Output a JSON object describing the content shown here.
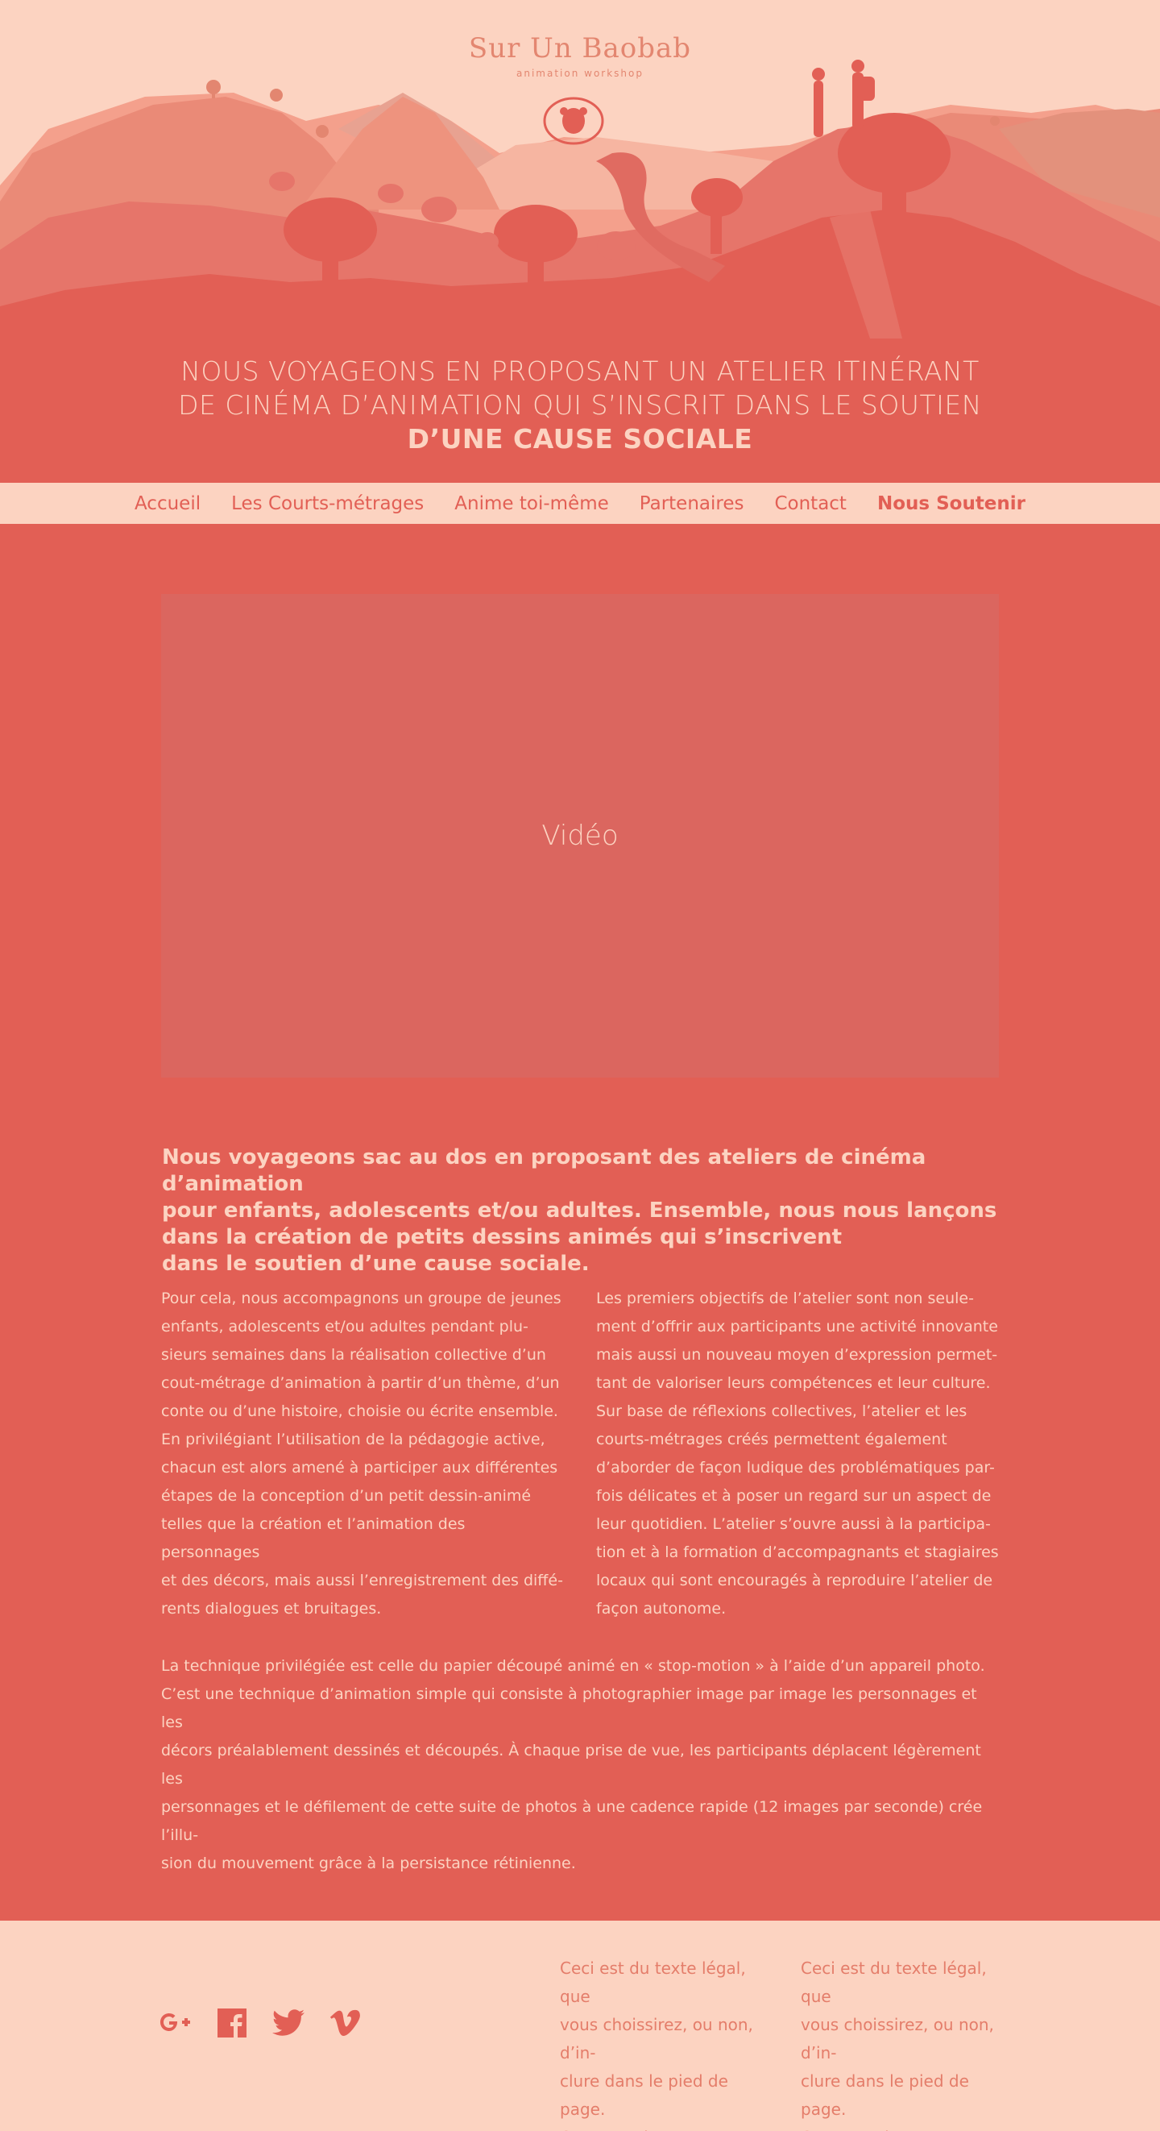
{
  "brand": {
    "name": "Sur Un Baobab",
    "subtitle": "animation workshop"
  },
  "headline": {
    "line1": "NOUS VOYAGEONS EN PROPOSANT UN ATELIER ITINÉRANT",
    "line2": "DE CINÉMA D’ANIMATION QUI S’INSCRIT DANS LE SOUTIEN",
    "line3": "D’UNE CAUSE SOCIALE"
  },
  "nav": {
    "items": [
      {
        "label": "Accueil"
      },
      {
        "label": "Les Courts-métrages"
      },
      {
        "label": "Anime toi-même"
      },
      {
        "label": "Partenaires"
      },
      {
        "label": "Contact"
      },
      {
        "label": "Nous Soutenir"
      }
    ]
  },
  "video": {
    "label": "Vidéo"
  },
  "intro": {
    "text": "Nous voyageons sac au dos en proposant des ateliers de cinéma d’animation\npour enfants, adolescents et/ou adultes. Ensemble, nous nous lançons\ndans la création de petits dessins animés qui s’inscrivent\ndans le soutien d’une cause sociale."
  },
  "columns": {
    "left": "Pour cela, nous accompagnons un groupe de jeunes\nenfants, adolescents et/ou adultes pendant plu-\nsieurs semaines dans la réalisation collective d’un\ncout-métrage d’animation à partir d’un thème, d’un\nconte ou d’une histoire, choisie ou écrite ensemble.\nEn privilégiant l’utilisation de la pédagogie active,\nchacun est alors amené à participer aux différentes\nétapes de la conception d’un petit dessin-animé\ntelles que la création et l’animation des personnages\net des décors, mais aussi l’enregistrement des diffé-\nrents dialogues et bruitages.",
    "right": "Les premiers objectifs de l’atelier sont non seule-\nment d’offrir aux participants une activité innovante\nmais aussi un nouveau moyen d’expression permet-\ntant de valoriser leurs compétences et leur culture.\nSur base de réflexions collectives, l’atelier et les\ncourts-métrages créés permettent également\nd’aborder de façon ludique des problématiques par-\nfois délicates et à poser un regard sur un aspect de\nleur quotidien. L’atelier s’ouvre aussi à la participa-\ntion et à la formation d’accompagnants et stagiaires\nlocaux qui sont encouragés à reproduire l’atelier de\nfaçon autonome."
  },
  "technique": {
    "text": "La technique privilégiée est celle du papier découpé animé en « stop-motion » à l’aide d’un appareil photo.\nC’est une technique d’animation simple qui consiste à photographier image par image les personnages et les\ndécors préalablement dessinés et découpés. À chaque prise de vue, les participants déplacent légèrement les\npersonnages et le défilement de cette suite de photos à une cadence rapide (12 images par seconde) crée l’illu-\nsion du mouvement grâce à la persistance rétinienne."
  },
  "footer": {
    "social": [
      {
        "icon": "google-plus-icon"
      },
      {
        "icon": "facebook-icon"
      },
      {
        "icon": "twitter-icon"
      },
      {
        "icon": "vimeo-icon"
      }
    ],
    "legal1": "Ceci est du texte légal, que\nvous choissirez, ou non, d’in-\nclure dans le pied de page.\nOu un quelconque autre\ntexte.",
    "legal2": "Ceci est du texte légal, que\nvous choissirez, ou non, d’in-\nclure dans le pied de page.\nOu un quelconque autre\ntexte."
  },
  "colors": {
    "primary": "#e25f55",
    "cream": "#fcd3c1",
    "video_bg": "#db665f",
    "legal_text": "#e47d6a"
  }
}
